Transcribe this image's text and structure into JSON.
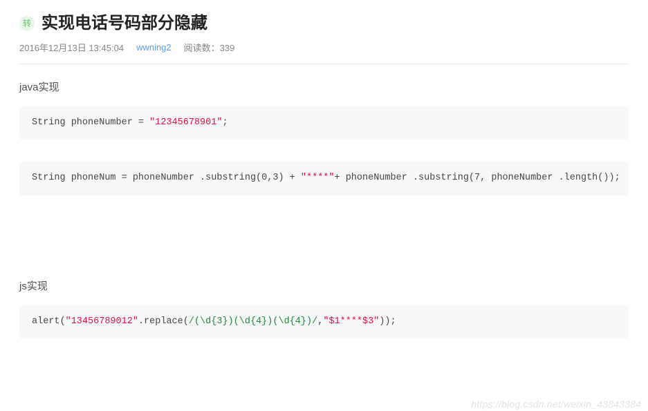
{
  "header": {
    "badge_text": "转",
    "title": "实现电话号码部分隐藏",
    "date": "2016年12月13日 13:45:04",
    "author": "wwning2",
    "reads_label": "阅读数：",
    "reads_value": "339"
  },
  "sections": {
    "java_heading": "java实现",
    "js_heading": "js实现"
  },
  "code": {
    "java1": {
      "p1": "String phoneNumber = ",
      "str1": "\"12345678901\"",
      "p2": ";"
    },
    "java2": {
      "p1": "String phoneNum = phoneNumber .substring(",
      "a1": "0",
      "p2": ",",
      "a2": "3",
      "p3": ") + ",
      "str1": "\"****\"",
      "p4": "+ phoneNumber .substring(",
      "a3": "7",
      "p5": ", phoneNumber .length());"
    },
    "js1": {
      "p1": "alert(",
      "str1": "\"13456789012\"",
      "p2": ".replace(",
      "regex": "/(\\d{3})(\\d{4})(\\d{4})/",
      "p3": ",",
      "str2": "\"$1****$3\"",
      "p4": "));"
    }
  },
  "watermark": "https://blog.csdn.net/weixin_43843384"
}
